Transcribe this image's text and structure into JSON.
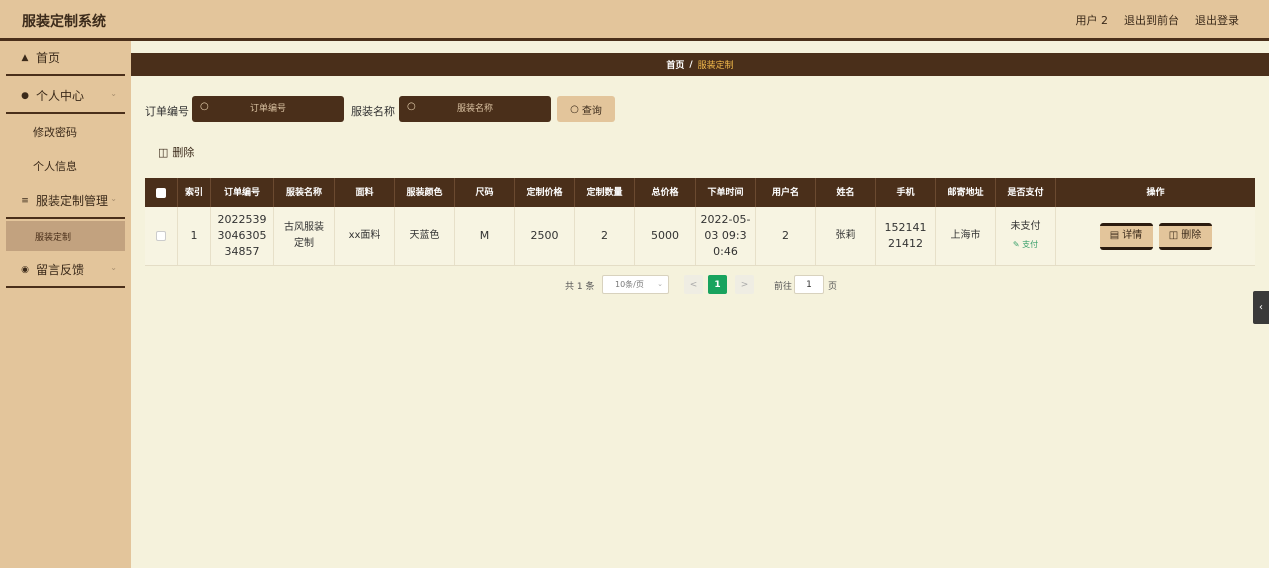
{
  "app": {
    "title": "服装定制系统"
  },
  "header": {
    "user": "用户 2",
    "front": "退出到前台",
    "logout": "退出登录"
  },
  "sidebar": {
    "home": "首页",
    "personal": "个人中心",
    "change_pwd": "修改密码",
    "personal_info": "个人信息",
    "custom_mgmt": "服装定制管理",
    "custom": "服装定制",
    "feedback": "留言反馈"
  },
  "breadcrumb": {
    "home": "首页",
    "sep": "/",
    "current": "服装定制"
  },
  "search": {
    "order_label": "订单编号",
    "order_placeholder": "订单编号",
    "name_label": "服装名称",
    "name_placeholder": "服装名称",
    "button": "查询"
  },
  "toolbar": {
    "delete": "删除"
  },
  "table": {
    "headers": [
      "索引",
      "订单编号",
      "服装名称",
      "面料",
      "服装颜色",
      "尺码",
      "定制价格",
      "定制数量",
      "总价格",
      "下单时间",
      "用户名",
      "姓名",
      "手机",
      "邮寄地址",
      "是否支付",
      "操作"
    ],
    "rows": [
      {
        "index": "1",
        "order_no": "2022539304630534857",
        "name": "古风服装定制",
        "fabric": "xx面料",
        "color": "天蓝色",
        "size": "M",
        "price": "2500",
        "qty": "2",
        "total": "5000",
        "time": "2022-05-03 09:30:46",
        "username": "2",
        "realname": "张莉",
        "phone": "15214121412",
        "address": "上海市",
        "paid": "未支付",
        "pay_action": "支付",
        "detail_btn": "详情",
        "delete_btn": "删除"
      }
    ]
  },
  "pagination": {
    "total": "共 1 条",
    "page_size": "10条/页",
    "current": "1",
    "goto_prefix": "前往",
    "goto_value": "1",
    "goto_suffix": "页"
  },
  "colors": {
    "dark": "#4a2f1a",
    "tan": "#e3c59b",
    "bg": "#f5f2dc",
    "green": "#18a35e"
  }
}
